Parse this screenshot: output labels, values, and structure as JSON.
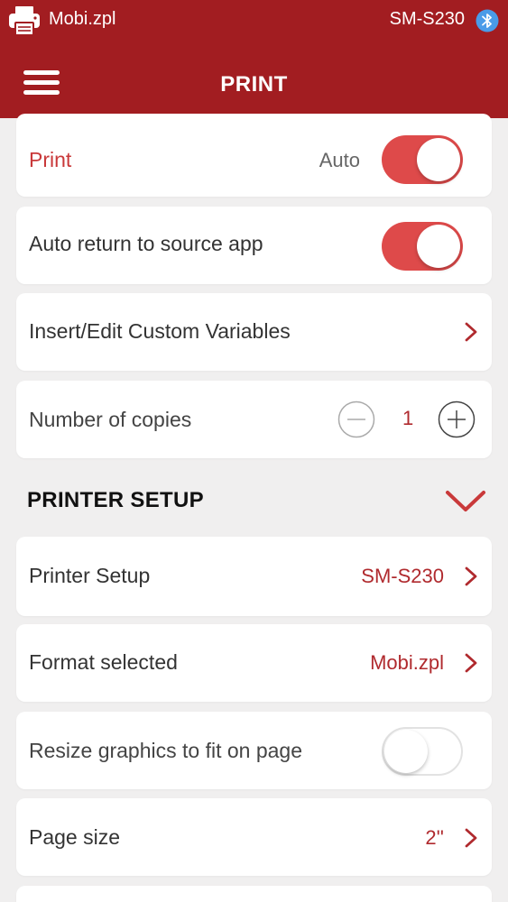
{
  "status_bar": {
    "file_name": "Mobi.zpl",
    "device_name": "SM-S230"
  },
  "nav": {
    "title": "PRINT"
  },
  "print_settings": {
    "print_label": "Print",
    "print_mode": "Auto",
    "print_toggle_on": true,
    "auto_return_label": "Auto return to source app",
    "auto_return_on": true,
    "custom_variables_label": "Insert/Edit Custom Variables",
    "copies_label": "Number of copies",
    "copies_value": "1"
  },
  "printer_setup": {
    "section_title": "PRINTER SETUP",
    "printer_label": "Printer Setup",
    "printer_value": "SM-S230",
    "format_label": "Format selected",
    "format_value": "Mobi.zpl",
    "resize_label": "Resize graphics to fit on page",
    "resize_on": false,
    "page_size_label": "Page size",
    "page_size_value": "2''"
  },
  "colors": {
    "brand": "#a21d21",
    "toggle_on": "#de4a4a",
    "accent_text": "#b02a2e"
  },
  "icons": [
    "printer-icon",
    "bluetooth-icon",
    "hamburger-menu-icon",
    "chevron-right-icon",
    "chevron-down-icon",
    "minus-circle-icon",
    "plus-circle-icon"
  ]
}
